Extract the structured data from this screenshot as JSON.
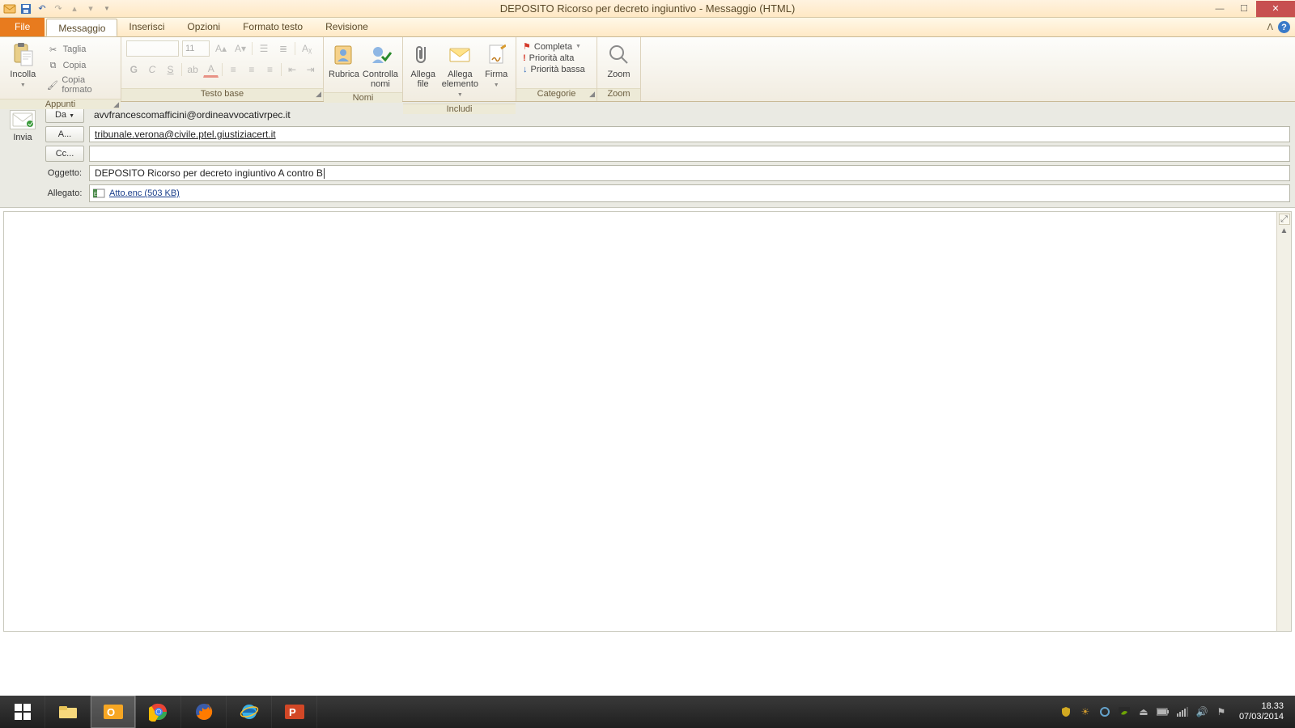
{
  "window": {
    "title": "DEPOSITO Ricorso per decreto ingiuntivo - Messaggio (HTML)"
  },
  "tabs": {
    "file": "File",
    "message": "Messaggio",
    "insert": "Inserisci",
    "options": "Opzioni",
    "format": "Formato testo",
    "review": "Revisione"
  },
  "ribbon": {
    "clipboard": {
      "paste": "Incolla",
      "cut": "Taglia",
      "copy": "Copia",
      "format_painter": "Copia formato",
      "group": "Appunti"
    },
    "font": {
      "size": "11",
      "bold": "G",
      "italic": "C",
      "underline": "S",
      "group": "Testo base"
    },
    "names": {
      "address_book": "Rubrica",
      "check_names": "Controlla nomi",
      "group": "Nomi"
    },
    "include": {
      "attach_file": "Allega file",
      "attach_item": "Allega elemento",
      "signature": "Firma",
      "group": "Includi"
    },
    "tags": {
      "follow_up": "Completa",
      "high": "Priorità alta",
      "low": "Priorità bassa",
      "group": "Categorie"
    },
    "zoom": {
      "label": "Zoom",
      "group": "Zoom"
    }
  },
  "compose": {
    "send": "Invia",
    "from_btn": "Da",
    "to_btn": "A...",
    "cc_btn": "Cc...",
    "subject_label": "Oggetto:",
    "attach_label": "Allegato:",
    "from_value": "avvfrancescomafficini@ordineavvocativrpec.it",
    "to_value": "tribunale.verona@civile.ptel.giustiziacert.it",
    "cc_value": "",
    "subject_value": "DEPOSITO Ricorso per decreto ingiuntivo A contro B",
    "attachment": {
      "name": "Atto.enc (503 KB)"
    }
  },
  "taskbar": {
    "time": "18.33",
    "date": "07/03/2014"
  }
}
